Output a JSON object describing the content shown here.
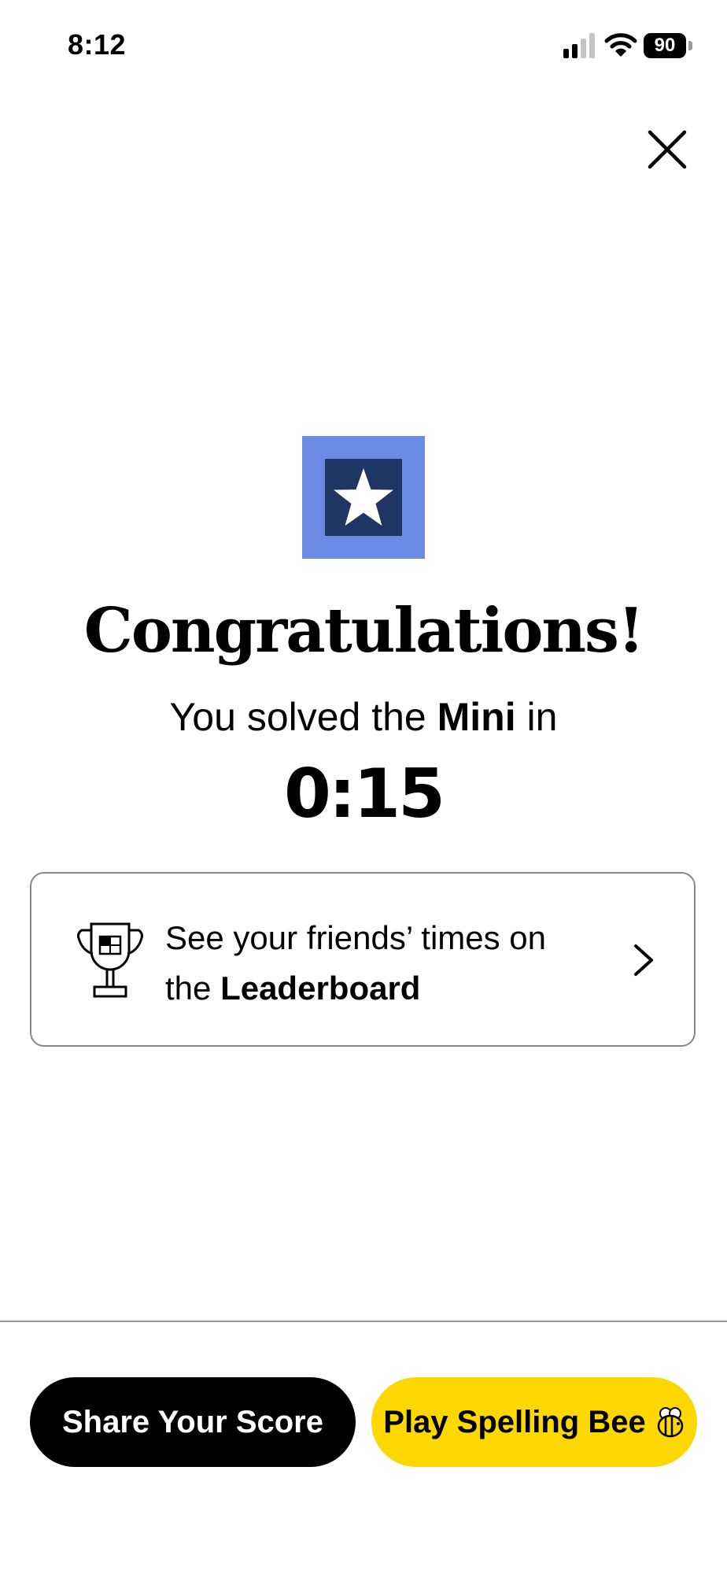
{
  "status_bar": {
    "time": "8:12",
    "battery_level": "90",
    "signal_icon": "cellular-signal-icon",
    "wifi_icon": "wifi-icon",
    "battery_icon": "battery-icon"
  },
  "close": {
    "icon": "close-icon"
  },
  "hero": {
    "badge_icon": "star-badge-icon",
    "title": "Congratulations!",
    "subtitle_prefix": "You solved the ",
    "subtitle_game": "Mini",
    "subtitle_suffix": " in",
    "solve_time": "0:15"
  },
  "leaderboard": {
    "icon": "trophy-icon",
    "text_line1": "See your friends’ times on",
    "text_prefix": "the ",
    "text_bold": "Leaderboard",
    "chevron_icon": "chevron-right-icon"
  },
  "actions": {
    "share_label": "Share Your Score",
    "bee_label": "Play Spelling Bee",
    "bee_icon": "bee-icon"
  },
  "colors": {
    "badge_outer": "#6a8ae3",
    "badge_inner": "#1f3662",
    "share_button": "#000000",
    "bee_button": "#fcd800"
  }
}
